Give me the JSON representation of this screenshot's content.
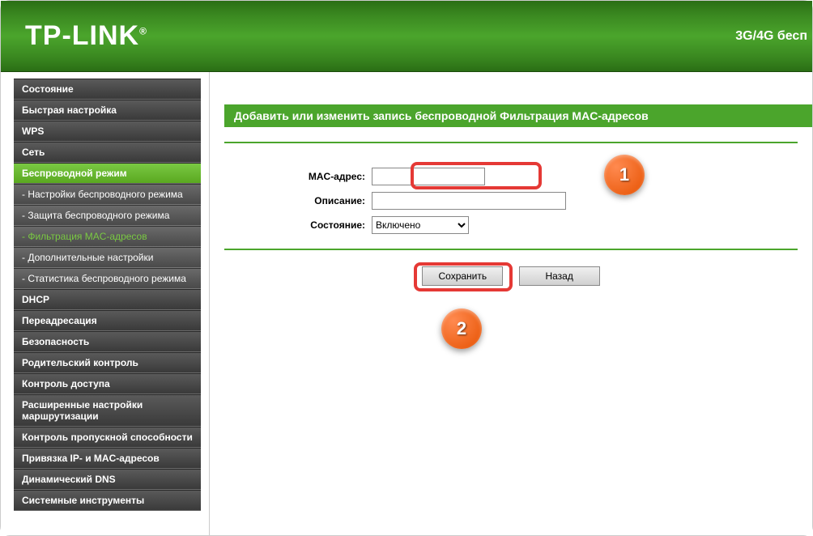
{
  "header": {
    "logo": "TP-LINK",
    "logo_reg": "®",
    "right_text": "3G/4G бесп"
  },
  "sidebar": {
    "items": [
      {
        "label": "Состояние",
        "type": "menu"
      },
      {
        "label": "Быстрая настройка",
        "type": "menu"
      },
      {
        "label": "WPS",
        "type": "menu"
      },
      {
        "label": "Сеть",
        "type": "menu"
      },
      {
        "label": "Беспроводной режим",
        "type": "menu",
        "active": true
      },
      {
        "label": "- Настройки беспроводного режима",
        "type": "submenu"
      },
      {
        "label": "- Защита беспроводного режима",
        "type": "submenu"
      },
      {
        "label": "- Фильтрация MAC-адресов",
        "type": "submenu",
        "active": true
      },
      {
        "label": "- Дополнительные настройки",
        "type": "submenu"
      },
      {
        "label": "- Статистика беспроводного режима",
        "type": "submenu"
      },
      {
        "label": "DHCP",
        "type": "menu"
      },
      {
        "label": "Переадресация",
        "type": "menu"
      },
      {
        "label": "Безопасность",
        "type": "menu"
      },
      {
        "label": "Родительский контроль",
        "type": "menu"
      },
      {
        "label": "Контроль доступа",
        "type": "menu"
      },
      {
        "label": "Расширенные настройки маршрутизации",
        "type": "menu"
      },
      {
        "label": "Контроль пропускной способности",
        "type": "menu"
      },
      {
        "label": "Привязка IP- и MAC-адресов",
        "type": "menu"
      },
      {
        "label": "Динамический DNS",
        "type": "menu"
      },
      {
        "label": "Системные инструменты",
        "type": "menu"
      }
    ]
  },
  "content": {
    "title": "Добавить или изменить запись беспроводной Фильтрация MAC-адресов",
    "form": {
      "mac_label": "MAC-адрес:",
      "mac_value": "",
      "desc_label": "Описание:",
      "desc_value": "",
      "state_label": "Состояние:",
      "state_value": "Включено"
    },
    "buttons": {
      "save": "Сохранить",
      "back": "Назад"
    }
  },
  "annotations": {
    "step1": "1",
    "step2": "2"
  }
}
